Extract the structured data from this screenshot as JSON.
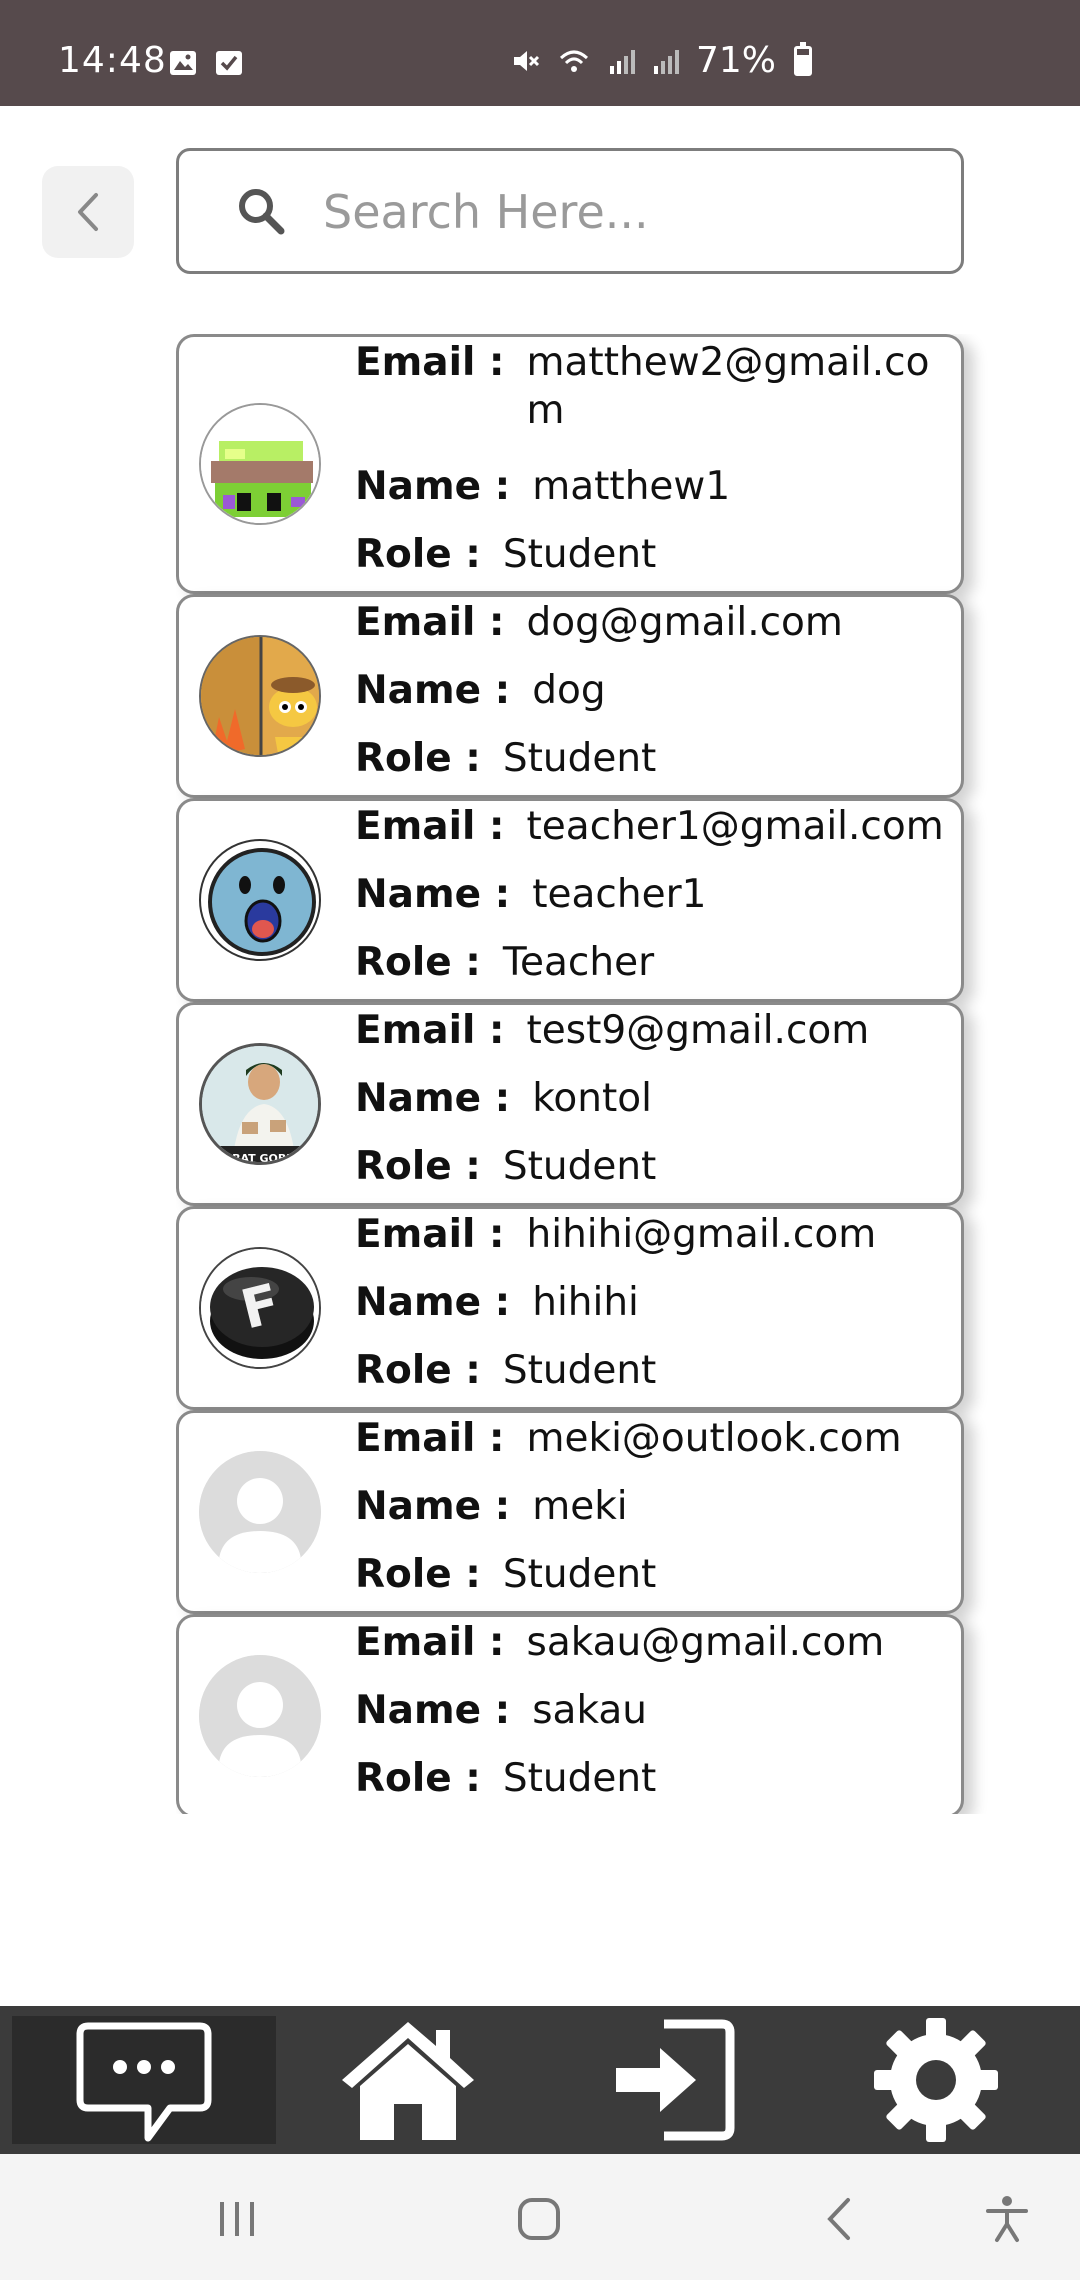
{
  "status_bar": {
    "time": "14:48",
    "battery": "71%",
    "battery_level": 0.71,
    "left_icons": [
      "image-icon",
      "check-box-icon"
    ],
    "right_icons": [
      "mute-icon",
      "wifi-icon",
      "signal-icon",
      "signal-icon"
    ]
  },
  "header": {
    "search_placeholder": "Search Here..."
  },
  "users": [
    {
      "email": "matthew2@gmail.com",
      "name": "matthew1",
      "role": "Student",
      "avatar": "pixel-art-avatar"
    },
    {
      "email": "dog@gmail.com",
      "name": "dog",
      "role": "Student",
      "avatar": "cartoon-dog-avatar"
    },
    {
      "email": "teacher1@gmail.com",
      "name": "teacher1",
      "role": "Teacher",
      "avatar": "blue-face-avatar"
    },
    {
      "email": "test9@gmail.com",
      "name": "kontol",
      "role": "Student",
      "avatar": "photo-avatar"
    },
    {
      "email": "hihihi@gmail.com",
      "name": "hihihi",
      "role": "Student",
      "avatar": "f-key-avatar"
    },
    {
      "email": "meki@outlook.com",
      "name": "meki",
      "role": "Student",
      "avatar": "default-avatar"
    },
    {
      "email": "sakau@gmail.com",
      "name": "sakau",
      "role": "Student",
      "avatar": "default-avatar"
    }
  ],
  "labels": {
    "email": "Email :",
    "name": "Name :",
    "role": "Role :"
  },
  "avatar_caption": "TOBAT GOBLOK",
  "bottom_nav": [
    {
      "icon": "chat-icon",
      "active": true
    },
    {
      "icon": "home-icon",
      "active": false
    },
    {
      "icon": "login-icon",
      "active": false
    },
    {
      "icon": "gear-icon",
      "active": false
    }
  ],
  "colors": {
    "status_bar": "#564a4c",
    "bottom_nav": "#3b3b3b",
    "card_border": "#8a8a8a"
  }
}
